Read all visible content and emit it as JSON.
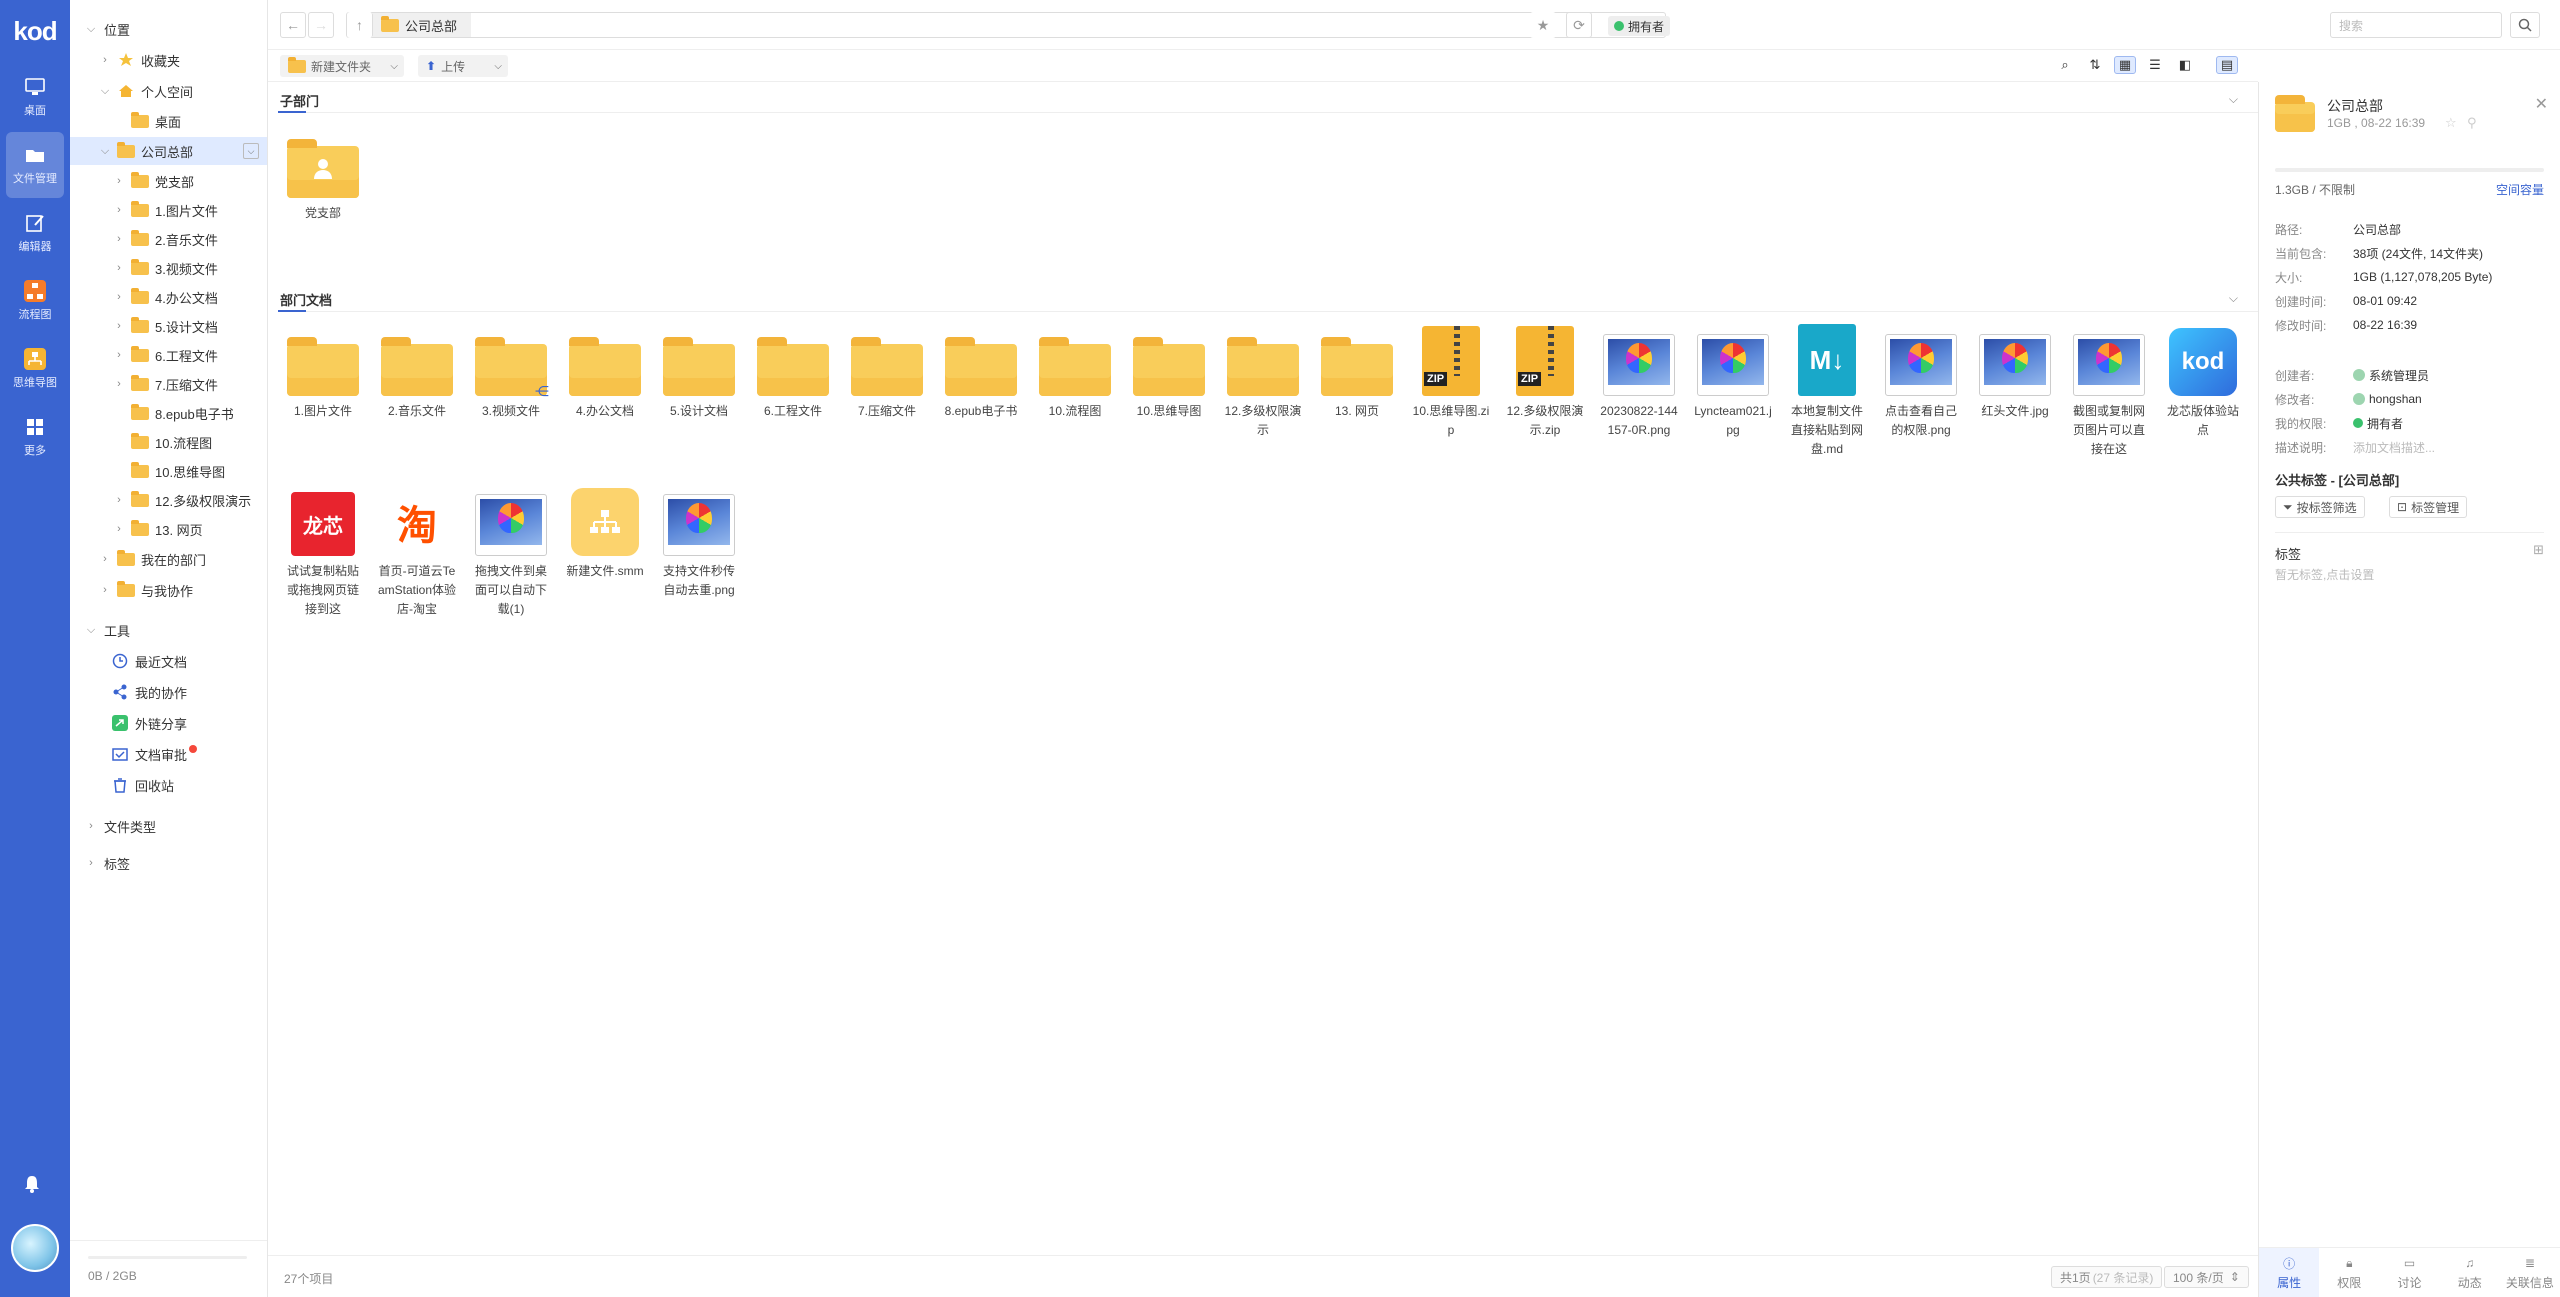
{
  "app": {
    "logo": "kod"
  },
  "nav": {
    "items": [
      {
        "label": "桌面",
        "icon": "monitor-icon"
      },
      {
        "label": "文件管理",
        "icon": "folder-icon",
        "active": true
      },
      {
        "label": "编辑器",
        "icon": "edit-icon"
      },
      {
        "label": "流程图",
        "icon": "flowchart-icon"
      },
      {
        "label": "思维导图",
        "icon": "mindmap-icon"
      },
      {
        "label": "更多",
        "icon": "grid-icon"
      }
    ]
  },
  "tree": {
    "position_header": "位置",
    "favorites": "收藏夹",
    "personal_space": "个人空间",
    "desktop": "桌面",
    "company": "公司总部",
    "children": [
      "党支部",
      "1.图片文件",
      "2.音乐文件",
      "3.视频文件",
      "4.办公文档",
      "5.设计文档",
      "6.工程文件",
      "7.压缩文件",
      "8.epub电子书",
      "10.流程图",
      "10.思维导图",
      "12.多级权限演示",
      "13. 网页"
    ],
    "my_dept": "我在的部门",
    "collab": "与我协作",
    "tools_header": "工具",
    "tools": [
      "最近文档",
      "我的协作",
      "外链分享",
      "文档审批",
      "回收站"
    ],
    "file_types": "文件类型",
    "tags": "标签",
    "storage": "0B / 2GB"
  },
  "topbar": {
    "breadcrumb": "公司总部",
    "owner": "拥有者",
    "search_placeholder": "搜索"
  },
  "toolbar": {
    "new_folder": "新建文件夹",
    "upload": "上传"
  },
  "sections": {
    "sub_dept_title": "子部门",
    "dept_docs_title": "部门文档"
  },
  "sub_depts": [
    {
      "name": "党支部"
    }
  ],
  "files": [
    {
      "name": "1.图片文件",
      "type": "folder"
    },
    {
      "name": "2.音乐文件",
      "type": "folder"
    },
    {
      "name": "3.视频文件",
      "type": "folder-shared"
    },
    {
      "name": "4.办公文档",
      "type": "folder"
    },
    {
      "name": "5.设计文档",
      "type": "folder"
    },
    {
      "name": "6.工程文件",
      "type": "folder"
    },
    {
      "name": "7.压缩文件",
      "type": "folder"
    },
    {
      "name": "8.epub电子书",
      "type": "folder"
    },
    {
      "name": "10.流程图",
      "type": "folder"
    },
    {
      "name": "10.思维导图",
      "type": "folder"
    },
    {
      "name": "12.多级权限演示",
      "type": "folder"
    },
    {
      "name": "13. 网页",
      "type": "folder"
    },
    {
      "name": "10.思维导图.zip",
      "type": "zip"
    },
    {
      "name": "12.多级权限演示.zip",
      "type": "zip"
    },
    {
      "name": "20230822-144157-0R.png",
      "type": "image"
    },
    {
      "name": "Lyncteam021.jpg",
      "type": "image"
    },
    {
      "name": "本地复制文件直接粘贴到网盘.md",
      "type": "md"
    },
    {
      "name": "点击查看自己的权限.png",
      "type": "image"
    },
    {
      "name": "红头文件.jpg",
      "type": "image"
    },
    {
      "name": "截图或复制网页图片可以直接在这",
      "type": "image"
    },
    {
      "name": "龙芯版体验站点",
      "type": "kod"
    },
    {
      "name": "试试复制粘贴或拖拽网页链接到这",
      "type": "loongson"
    },
    {
      "name": "首页-可道云TeamStation体验店-淘宝",
      "type": "taobao"
    },
    {
      "name": "拖拽文件到桌面可以自动下载(1)",
      "type": "image"
    },
    {
      "name": "新建文件.smm",
      "type": "smm"
    },
    {
      "name": "支持文件秒传自动去重.png",
      "type": "image"
    }
  ],
  "icon_text": {
    "zip": "ZIP",
    "md": "M↓",
    "kod": "kod",
    "loongson": "龙芯",
    "taobao": "淘"
  },
  "status": {
    "count": "27个项目",
    "pages": "共1页",
    "records": "(27 条记录)",
    "per_page": "100 条/页"
  },
  "props": {
    "title": "公司总部",
    "subtitle": "1GB , 08-22 16:39",
    "quota": "1.3GB / 不限制",
    "quota_link": "空间容量",
    "rows": [
      {
        "key": "路径:",
        "val": "公司总部"
      },
      {
        "key": "当前包含:",
        "val": "38项 (24文件, 14文件夹)"
      },
      {
        "key": "大小:",
        "val": "1GB (1,127,078,205 Byte)"
      },
      {
        "key": "创建时间:",
        "val": "08-01 09:42"
      },
      {
        "key": "修改时间:",
        "val": "08-22 16:39"
      },
      {
        "key": "创建者:",
        "val": "系统管理员"
      },
      {
        "key": "修改者:",
        "val": "hongshan"
      },
      {
        "key": "我的权限:",
        "val": "拥有者"
      },
      {
        "key": "描述说明:",
        "val": "添加文档描述..."
      }
    ],
    "public_tags": "公共标签 - [公司总部]",
    "filter_btn": "按标签筛选",
    "manage_btn": "标签管理",
    "tags_title": "标签",
    "no_tags": "暂无标签,点击设置",
    "tabs": [
      "属性",
      "权限",
      "讨论",
      "动态",
      "关联信息"
    ]
  },
  "colors": {
    "accent": "#3a64d0",
    "folder": "#f9cd5a",
    "owner_dot": "#3ac16d"
  }
}
